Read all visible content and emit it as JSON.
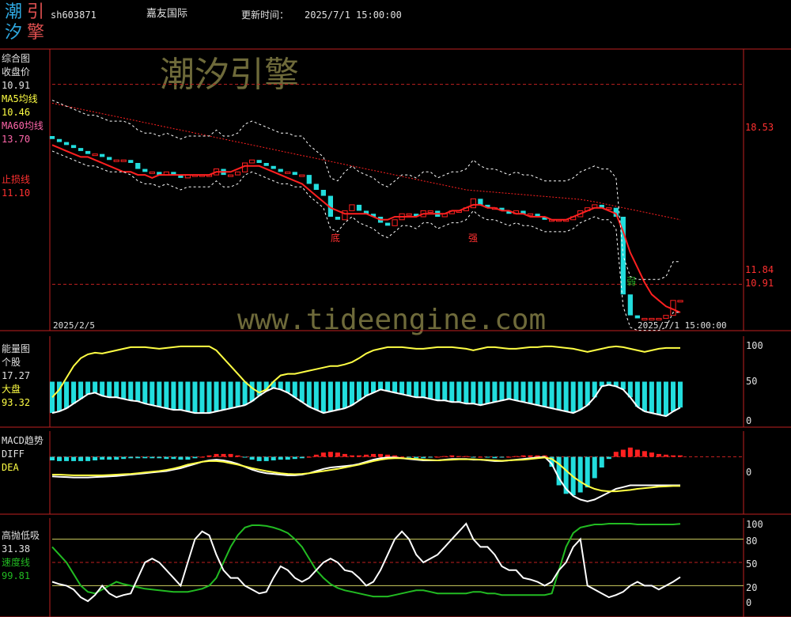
{
  "logo": {
    "text": [
      "潮",
      "引",
      "汐",
      "擎"
    ]
  },
  "header": {
    "code": "sh603871",
    "name": "嘉友国际",
    "update_label": "更新时间：",
    "update_time": "2025/7/1 15:00:00"
  },
  "watermarks": {
    "brand": "潮汐引擎",
    "url": "www.tideengine.com"
  },
  "colors": {
    "bg": "#000000",
    "up": "#ff2020",
    "down": "#22dddd",
    "yellow": "#ffff44",
    "white": "#ffffff",
    "green": "#22bb22",
    "grid": "#c02020",
    "axis": "#c02020"
  },
  "panels": {
    "main": {
      "title": "综合图",
      "close_label": "收盘价",
      "close_value": "10.91",
      "ma5_label": "MA5均线",
      "ma5_value": "10.46",
      "ma60_label": "MA60均线",
      "ma60_value": "13.70",
      "stop_label": "止损线",
      "stop_value": "11.10",
      "axis_labels": [
        "18.53",
        "11.84",
        "10.91"
      ],
      "date_start": "2025/2/5",
      "date_end": "2025/7/1 15:00:00",
      "markers": [
        "底",
        "强",
        "弱"
      ]
    },
    "energy": {
      "title": "能量图",
      "stock_label": "个股",
      "stock_value": "17.27",
      "market_label": "大盘",
      "market_value": "93.32",
      "axis_labels": [
        "100",
        "50",
        "0"
      ]
    },
    "macd": {
      "title": "MACD趋势",
      "diff_label": "DIFF",
      "dea_label": "DEA",
      "axis_labels": [
        "0"
      ]
    },
    "sell": {
      "title": "高抛低吸",
      "value_a": "31.38",
      "speed_label": "速度线",
      "speed_value": "99.81",
      "axis_labels": [
        "100",
        "80",
        "50",
        "20",
        "0"
      ]
    }
  },
  "chart_data": [
    {
      "type": "candlestick",
      "title": "综合图",
      "x_start": "2025/2/5",
      "x_end": "2025/7/1",
      "ylim": [
        10.5,
        19.5
      ],
      "reference_lines": [
        18.53,
        11.84
      ],
      "close": [
        16.7,
        16.6,
        16.5,
        16.4,
        16.3,
        16.2,
        16.2,
        16.1,
        16.0,
        16.0,
        16.0,
        15.9,
        15.7,
        15.6,
        15.6,
        15.5,
        15.6,
        15.5,
        15.4,
        15.5,
        15.5,
        15.5,
        15.5,
        15.7,
        15.5,
        15.5,
        15.6,
        15.9,
        16.0,
        15.9,
        15.8,
        15.7,
        15.6,
        15.6,
        15.5,
        15.5,
        15.2,
        15.0,
        14.8,
        14.1,
        14.0,
        14.3,
        14.5,
        14.3,
        14.2,
        14.1,
        13.9,
        13.8,
        14.0,
        14.2,
        14.2,
        14.1,
        14.3,
        14.3,
        14.1,
        14.2,
        14.3,
        14.3,
        14.4,
        14.7,
        14.5,
        14.4,
        14.4,
        14.3,
        14.2,
        14.3,
        14.2,
        14.2,
        14.1,
        14.0,
        14.0,
        14.0,
        14.0,
        14.1,
        14.3,
        14.4,
        14.5,
        14.4,
        14.4,
        14.1,
        11.5,
        10.8,
        10.7,
        10.7,
        10.7,
        10.7,
        10.8,
        11.3,
        11.3
      ],
      "ma5": [
        16.5,
        16.4,
        16.3,
        16.2,
        16.1,
        16.1,
        16.0,
        15.9,
        15.8,
        15.7,
        15.6,
        15.6,
        15.5,
        15.5,
        15.4,
        15.5,
        15.5,
        15.5,
        15.5,
        15.5,
        15.5,
        15.5,
        15.5,
        15.6,
        15.6,
        15.6,
        15.7,
        15.8,
        15.8,
        15.8,
        15.7,
        15.6,
        15.5,
        15.4,
        15.3,
        15.2,
        15.0,
        14.8,
        14.6,
        14.4,
        14.3,
        14.2,
        14.2,
        14.2,
        14.2,
        14.1,
        14.0,
        14.0,
        14.1,
        14.1,
        14.1,
        14.1,
        14.2,
        14.2,
        14.2,
        14.2,
        14.3,
        14.3,
        14.4,
        14.5,
        14.5,
        14.4,
        14.4,
        14.3,
        14.3,
        14.2,
        14.2,
        14.1,
        14.1,
        14.1,
        14.0,
        14.0,
        14.0,
        14.1,
        14.2,
        14.3,
        14.4,
        14.4,
        14.3,
        14.2,
        13.6,
        12.9,
        12.4,
        11.9,
        11.5,
        11.3,
        11.1,
        11.0,
        10.9
      ],
      "ma60": [
        17.9,
        17.85,
        17.8,
        17.75,
        17.7,
        17.65,
        17.6,
        17.55,
        17.5,
        17.45,
        17.4,
        17.35,
        17.3,
        17.25,
        17.2,
        17.15,
        17.1,
        17.05,
        17.0,
        16.95,
        16.9,
        16.85,
        16.8,
        16.75,
        16.7,
        16.65,
        16.6,
        16.55,
        16.5,
        16.45,
        16.4,
        16.35,
        16.3,
        16.25,
        16.2,
        16.15,
        16.1,
        16.05,
        16.0,
        15.95,
        15.9,
        15.85,
        15.8,
        15.75,
        15.7,
        15.65,
        15.6,
        15.55,
        15.5,
        15.45,
        15.4,
        15.35,
        15.3,
        15.25,
        15.2,
        15.15,
        15.1,
        15.05,
        15.0,
        14.98,
        14.96,
        14.94,
        14.92,
        14.9,
        14.88,
        14.86,
        14.84,
        14.82,
        14.8,
        14.78,
        14.76,
        14.74,
        14.72,
        14.7,
        14.68,
        14.64,
        14.6,
        14.55,
        14.5,
        14.45,
        14.4,
        14.35,
        14.3,
        14.25,
        14.2,
        14.15,
        14.1,
        14.05,
        14.0
      ]
    },
    {
      "type": "bar+line",
      "title": "能量图",
      "ylim": [
        0,
        100
      ],
      "series": [
        {
          "name": "个股",
          "values": [
            10,
            12,
            16,
            22,
            28,
            34,
            36,
            32,
            30,
            30,
            28,
            26,
            25,
            22,
            20,
            18,
            16,
            14,
            14,
            12,
            10,
            10,
            10,
            12,
            14,
            16,
            18,
            20,
            25,
            32,
            38,
            42,
            40,
            36,
            30,
            24,
            18,
            14,
            10,
            12,
            14,
            16,
            20,
            26,
            32,
            36,
            40,
            38,
            36,
            34,
            32,
            30,
            30,
            28,
            26,
            26,
            24,
            24,
            22,
            22,
            20,
            22,
            24,
            26,
            28,
            26,
            24,
            22,
            20,
            18,
            16,
            14,
            12,
            10,
            14,
            20,
            30,
            44,
            46,
            44,
            40,
            30,
            18,
            12,
            10,
            8,
            6,
            12,
            17
          ]
        },
        {
          "name": "大盘",
          "values": [
            30,
            40,
            55,
            70,
            80,
            85,
            87,
            86,
            88,
            90,
            92,
            94,
            94,
            94,
            93,
            92,
            93,
            94,
            95,
            95,
            95,
            95,
            95,
            90,
            80,
            70,
            60,
            50,
            42,
            36,
            40,
            50,
            58,
            60,
            60,
            62,
            64,
            66,
            68,
            70,
            70,
            72,
            75,
            80,
            86,
            90,
            92,
            94,
            94,
            94,
            93,
            92,
            92,
            93,
            94,
            94,
            94,
            93,
            92,
            90,
            92,
            94,
            94,
            93,
            92,
            92,
            93,
            94,
            94,
            95,
            95,
            94,
            93,
            92,
            90,
            88,
            90,
            92,
            94,
            95,
            94,
            92,
            90,
            88,
            90,
            92,
            93,
            93,
            93
          ]
        }
      ]
    },
    {
      "type": "bar+line",
      "title": "MACD趋势",
      "ylim": [
        -1.5,
        0.5
      ],
      "series": [
        {
          "name": "DIFF",
          "values": [
            -0.55,
            -0.56,
            -0.57,
            -0.58,
            -0.58,
            -0.58,
            -0.57,
            -0.56,
            -0.55,
            -0.54,
            -0.52,
            -0.5,
            -0.48,
            -0.46,
            -0.44,
            -0.42,
            -0.4,
            -0.36,
            -0.32,
            -0.26,
            -0.2,
            -0.14,
            -0.1,
            -0.08,
            -0.1,
            -0.14,
            -0.2,
            -0.28,
            -0.36,
            -0.42,
            -0.46,
            -0.48,
            -0.5,
            -0.52,
            -0.52,
            -0.5,
            -0.46,
            -0.4,
            -0.34,
            -0.3,
            -0.28,
            -0.26,
            -0.24,
            -0.2,
            -0.14,
            -0.08,
            -0.04,
            -0.02,
            -0.02,
            -0.04,
            -0.06,
            -0.08,
            -0.1,
            -0.1,
            -0.1,
            -0.08,
            -0.06,
            -0.06,
            -0.06,
            -0.08,
            -0.08,
            -0.1,
            -0.12,
            -0.12,
            -0.1,
            -0.08,
            -0.06,
            -0.04,
            -0.02,
            0.0,
            -0.2,
            -0.6,
            -0.9,
            -1.1,
            -1.2,
            -1.25,
            -1.2,
            -1.1,
            -1.0,
            -0.9,
            -0.85,
            -0.8,
            -0.8,
            -0.8,
            -0.8,
            -0.8,
            -0.8,
            -0.8,
            -0.8
          ]
        },
        {
          "name": "DEA",
          "values": [
            -0.5,
            -0.5,
            -0.51,
            -0.52,
            -0.52,
            -0.52,
            -0.52,
            -0.52,
            -0.51,
            -0.5,
            -0.49,
            -0.48,
            -0.46,
            -0.44,
            -0.42,
            -0.4,
            -0.37,
            -0.33,
            -0.28,
            -0.22,
            -0.18,
            -0.14,
            -0.12,
            -0.12,
            -0.14,
            -0.18,
            -0.22,
            -0.27,
            -0.32,
            -0.36,
            -0.4,
            -0.43,
            -0.46,
            -0.48,
            -0.49,
            -0.48,
            -0.46,
            -0.43,
            -0.4,
            -0.37,
            -0.34,
            -0.3,
            -0.26,
            -0.22,
            -0.17,
            -0.12,
            -0.08,
            -0.05,
            -0.04,
            -0.04,
            -0.05,
            -0.06,
            -0.08,
            -0.09,
            -0.1,
            -0.09,
            -0.08,
            -0.07,
            -0.07,
            -0.07,
            -0.08,
            -0.09,
            -0.1,
            -0.11,
            -0.1,
            -0.09,
            -0.08,
            -0.06,
            -0.04,
            -0.02,
            -0.06,
            -0.2,
            -0.38,
            -0.56,
            -0.7,
            -0.82,
            -0.9,
            -0.95,
            -0.97,
            -0.97,
            -0.95,
            -0.93,
            -0.9,
            -0.88,
            -0.86,
            -0.84,
            -0.83,
            -0.82,
            -0.82
          ]
        }
      ]
    },
    {
      "type": "line",
      "title": "高抛低吸",
      "ylim": [
        0,
        100
      ],
      "series": [
        {
          "name": "高抛低吸",
          "values": [
            25,
            22,
            20,
            15,
            5,
            0,
            8,
            20,
            10,
            5,
            8,
            10,
            30,
            50,
            55,
            50,
            40,
            30,
            20,
            50,
            80,
            90,
            85,
            60,
            40,
            30,
            30,
            20,
            15,
            10,
            12,
            30,
            45,
            40,
            30,
            25,
            30,
            40,
            50,
            55,
            50,
            40,
            38,
            30,
            20,
            25,
            40,
            60,
            80,
            90,
            80,
            60,
            50,
            55,
            60,
            70,
            80,
            90,
            100,
            80,
            70,
            70,
            60,
            45,
            40,
            40,
            30,
            28,
            25,
            20,
            25,
            40,
            50,
            70,
            80,
            20,
            15,
            10,
            5,
            8,
            12,
            20,
            25,
            20,
            20,
            15,
            20,
            25,
            31
          ]
        },
        {
          "name": "速度线",
          "values": [
            70,
            60,
            50,
            35,
            20,
            12,
            10,
            15,
            20,
            25,
            22,
            20,
            18,
            16,
            15,
            14,
            13,
            12,
            12,
            12,
            14,
            16,
            20,
            30,
            50,
            70,
            85,
            95,
            98,
            98,
            97,
            95,
            92,
            88,
            80,
            70,
            55,
            40,
            30,
            22,
            17,
            14,
            12,
            10,
            8,
            6,
            6,
            6,
            8,
            10,
            12,
            14,
            14,
            12,
            10,
            10,
            10,
            10,
            10,
            12,
            12,
            10,
            10,
            8,
            8,
            8,
            8,
            8,
            8,
            8,
            10,
            40,
            70,
            88,
            95,
            97,
            99,
            99,
            100,
            100,
            100,
            100,
            99,
            99,
            99,
            99,
            99,
            99,
            99.81
          ]
        }
      ]
    }
  ]
}
